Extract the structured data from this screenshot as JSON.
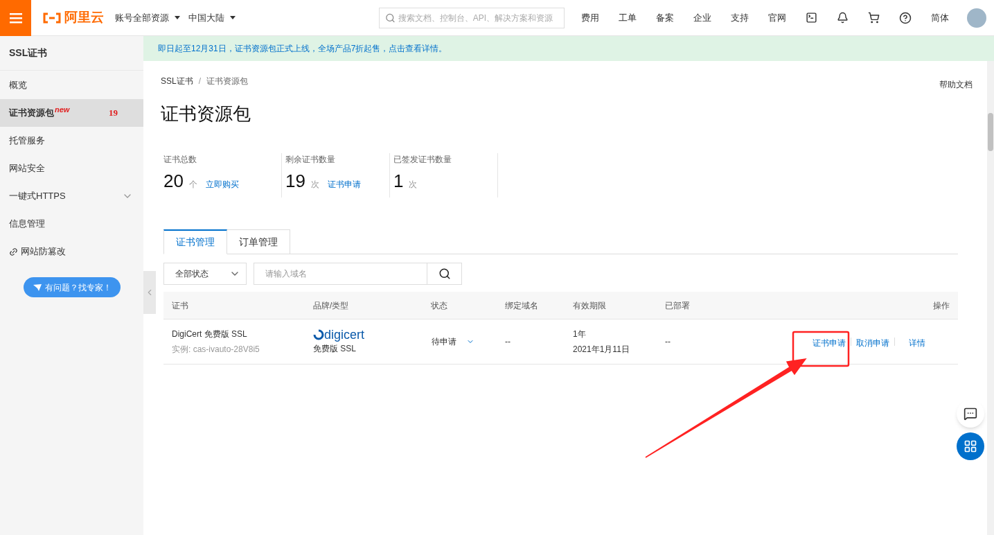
{
  "topbar": {
    "logo": "阿里云",
    "account": "账号全部资源",
    "region": "中国大陆",
    "search": {
      "placeholder": "搜索文档、控制台、API、解决方案和资源"
    },
    "links": [
      "费用",
      "工单",
      "备案",
      "企业",
      "支持",
      "官网"
    ],
    "language": "简体"
  },
  "sidebar": {
    "title": "SSL证书",
    "items": [
      {
        "label": "概览",
        "selected": false,
        "kind": "plain"
      },
      {
        "label": "证书资源包",
        "selected": true,
        "kind": "badge",
        "tag": "new",
        "count": "19"
      },
      {
        "label": "托管服务",
        "selected": false,
        "kind": "plain"
      },
      {
        "label": "网站安全",
        "selected": false,
        "kind": "plain"
      },
      {
        "label": "一键式HTTPS",
        "selected": false,
        "kind": "group",
        "expanded": false
      },
      {
        "label": "信息管理",
        "selected": false,
        "kind": "plain"
      },
      {
        "label": "网站防篡改",
        "selected": false,
        "kind": "link"
      }
    ],
    "help_button": "有问题？找专家！"
  },
  "banner": "即日起至12月31日，证书资源包正式上线，全场产品7折起售，点击查看详情。",
  "breadcrumb": [
    "SSL证书",
    "/",
    "证书资源包"
  ],
  "help_docs": "帮助文档",
  "page_title": "证书资源包",
  "stats": [
    {
      "label": "证书总数",
      "value": "20",
      "unit": "个",
      "link": "立即购买"
    },
    {
      "label": "剩余证书数量",
      "value": "19",
      "unit": "次",
      "link": "证书申请"
    },
    {
      "label": "已签发证书数量",
      "value": "1",
      "unit": "次"
    }
  ],
  "tabs": [
    {
      "label": "证书管理",
      "selected": true
    },
    {
      "label": "订单管理",
      "selected": false
    }
  ],
  "filter": {
    "status": "全部状态",
    "domain": {
      "placeholder": "请输入域名"
    }
  },
  "table": {
    "columns": [
      "证书",
      "品牌/类型",
      "状态",
      "绑定域名",
      "有效期限",
      "已部署",
      "操作"
    ],
    "rows": [
      {
        "name": "DigiCert 免费版 SSL",
        "instance": "实例: cas-ivauto-28V8i5",
        "brand": "digicert",
        "type": "免费版 SSL",
        "status": "待申请",
        "domain": "--",
        "period": "1年",
        "expiry": "2021年1月11日",
        "deployed": "--",
        "actions": [
          "证书申请",
          "取消申请",
          "详情"
        ]
      }
    ]
  }
}
